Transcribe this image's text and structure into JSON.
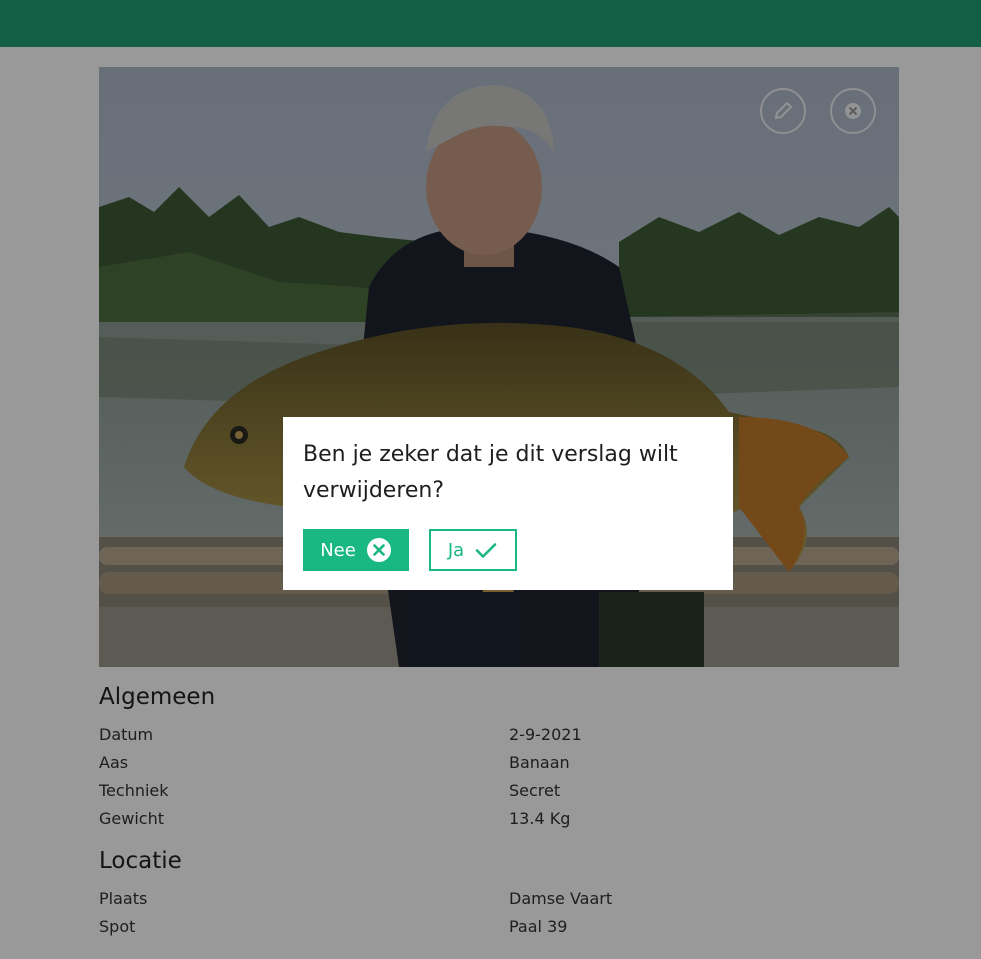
{
  "colors": {
    "header": "#1f9e74",
    "accent": "#19b883",
    "overlay": "rgba(0,0,0,0.40)"
  },
  "photo": {
    "subject": "man holding a large common carp by a lake",
    "actions": [
      {
        "name": "edit",
        "icon": "pencil-icon"
      },
      {
        "name": "delete",
        "icon": "close-circle-icon"
      }
    ]
  },
  "general": {
    "title": "Algemeen",
    "rows": [
      {
        "label": "Datum",
        "value": "2-9-2021"
      },
      {
        "label": "Aas",
        "value": "Banaan"
      },
      {
        "label": "Techniek",
        "value": "Secret"
      },
      {
        "label": "Gewicht",
        "value": "13.4 Kg"
      }
    ]
  },
  "location": {
    "title": "Locatie",
    "rows": [
      {
        "label": "Plaats",
        "value": "Damse Vaart"
      },
      {
        "label": "Spot",
        "value": "Paal 39"
      }
    ]
  },
  "dialog": {
    "message": "Ben je zeker dat je dit verslag wilt verwijderen?",
    "no_label": "Nee",
    "no_icon": "close-circle-icon",
    "yes_label": "Ja",
    "yes_icon": "check-icon"
  }
}
